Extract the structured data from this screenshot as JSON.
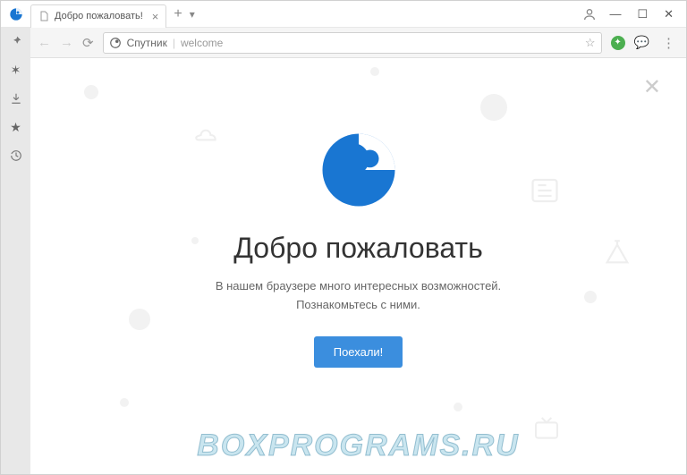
{
  "window": {
    "tab_title": "Добро пожаловать!",
    "user_icon": "user"
  },
  "addressbar": {
    "brand": "Спутник",
    "path": "welcome"
  },
  "sidebar": {
    "items": [
      {
        "name": "pin",
        "glyph": "📌"
      },
      {
        "name": "settings",
        "glyph": "✶"
      },
      {
        "name": "downloads",
        "glyph": "↓"
      },
      {
        "name": "bookmarks",
        "glyph": "★"
      },
      {
        "name": "history",
        "glyph": "↺"
      }
    ]
  },
  "welcome": {
    "heading": "Добро пожаловать",
    "line1": "В нашем браузере много интересных возможностей.",
    "line2": "Познакомьтесь с ними.",
    "cta": "Поехали!"
  },
  "watermark": "BOXPROGRAMS.RU"
}
